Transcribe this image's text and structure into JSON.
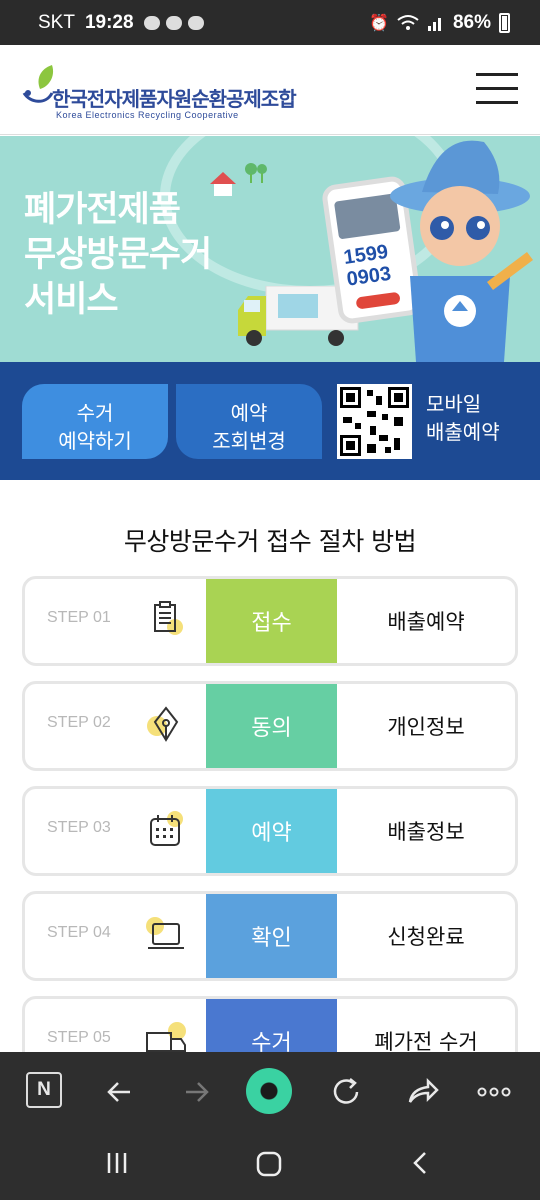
{
  "status_bar": {
    "carrier": "SKT",
    "time": "19:28",
    "battery": "86%"
  },
  "header": {
    "logo_ko": "한국전자제품자원순환공제조합",
    "logo_en": "Korea Electronics Recycling Cooperative",
    "menu_icon": "hamburger-menu-icon"
  },
  "banner": {
    "title_lines": [
      "폐가전제품",
      "무상방문수거",
      "서비스"
    ],
    "phone_number_lines": [
      "1599",
      "0903"
    ],
    "colors": {
      "background": "#9fdcd3",
      "title": "#ffffff"
    }
  },
  "actions": {
    "reserve_lines": [
      "수거",
      "예약하기"
    ],
    "lookup_lines": [
      "예약",
      "조회변경"
    ],
    "mobile_lines": [
      "모바일",
      "배출예약"
    ],
    "qr_icon": "qr-code-icon"
  },
  "process": {
    "title": "무상방문수거 접수 절차 방법",
    "steps": [
      {
        "no": "STEP 01",
        "label": "접수",
        "desc": "배출예약",
        "icon": "clipboard-icon",
        "color": "#a9d353"
      },
      {
        "no": "STEP 02",
        "label": "동의",
        "desc": "개인정보",
        "icon": "pen-nib-icon",
        "color": "#66cfa3"
      },
      {
        "no": "STEP 03",
        "label": "예약",
        "desc": "배출정보",
        "icon": "calendar-icon",
        "color": "#62cbe0"
      },
      {
        "no": "STEP 04",
        "label": "확인",
        "desc": "신청완료",
        "icon": "laptop-icon",
        "color": "#5ba1dd"
      },
      {
        "no": "STEP 05",
        "label": "수거",
        "desc": "폐가전 수거",
        "icon": "truck-icon",
        "color": "#4a78d0"
      }
    ]
  },
  "browser_toolbar": {
    "n_label": "N",
    "items": [
      "n-icon",
      "back-arrow-icon",
      "forward-arrow-icon",
      "home-circle-icon",
      "refresh-icon",
      "share-icon",
      "more-icon"
    ]
  },
  "system_nav": {
    "items": [
      "recent-apps-icon",
      "home-icon",
      "back-icon"
    ]
  }
}
